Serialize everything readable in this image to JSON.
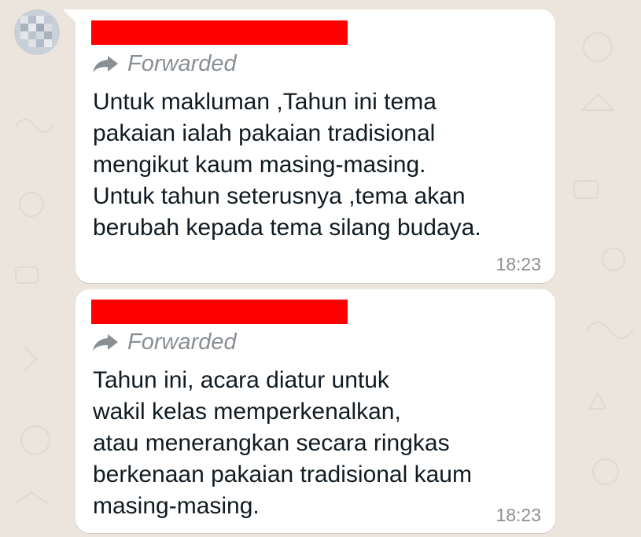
{
  "colors": {
    "background": "#ece5dd",
    "bubble": "#ffffff",
    "redaction": "#ff0000",
    "meta_text": "#8a8f94",
    "message_text": "#111b21"
  },
  "messages": [
    {
      "forwarded_icon": "forward-arrow-icon",
      "forwarded_label": "Forwarded",
      "lines": [
        "Untuk makluman ,Tahun ini tema",
        "pakaian ialah pakaian tradisional",
        "mengikut kaum masing-masing.",
        "Untuk tahun seterusnya ,tema akan",
        "berubah kepada tema silang budaya."
      ],
      "time": "18:23"
    },
    {
      "forwarded_icon": "forward-arrow-icon",
      "forwarded_label": "Forwarded",
      "lines": [
        "Tahun ini, acara diatur untuk",
        "wakil kelas memperkenalkan,",
        "atau menerangkan secara ringkas",
        "berkenaan pakaian tradisional kaum",
        "masing-masing."
      ],
      "time": "18:23"
    }
  ]
}
